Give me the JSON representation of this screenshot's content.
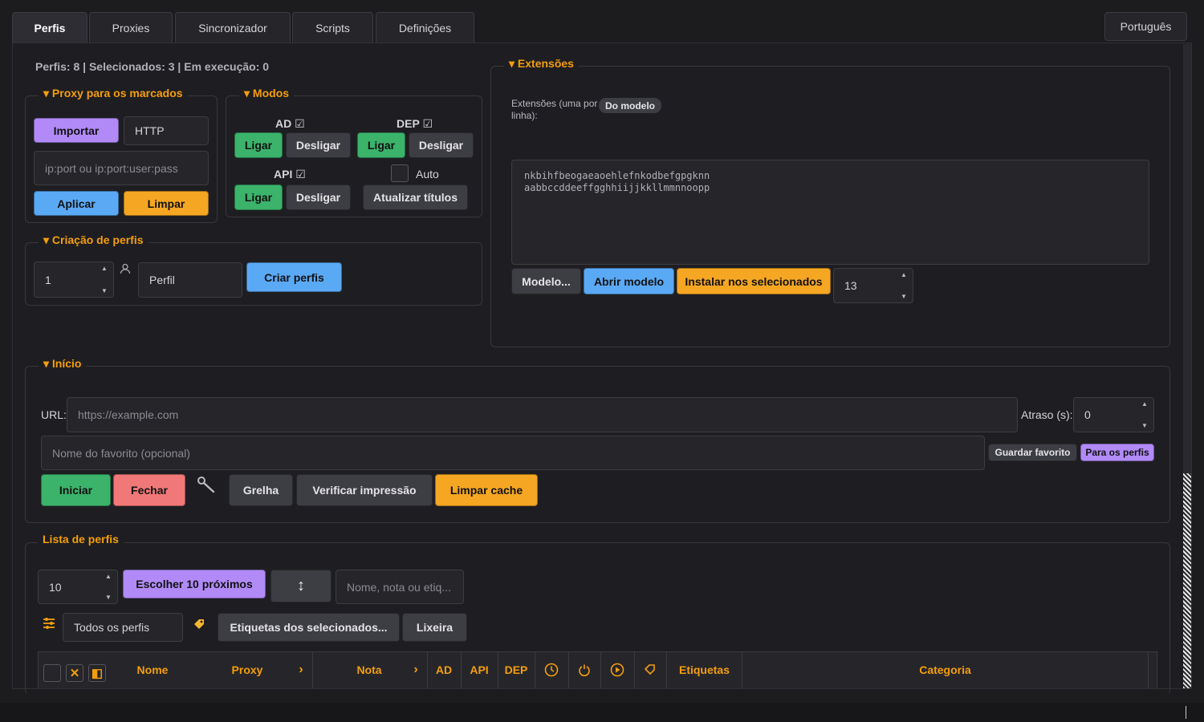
{
  "tabs": [
    "Perfis",
    "Proxies",
    "Sincronizador",
    "Scripts",
    "Definições"
  ],
  "language": "Português",
  "status": "Perfis: 8 | Selecionados: 3 | Em execução: 0",
  "proxy": {
    "title": "Proxy para os marcados",
    "import": "Importar",
    "type": "HTTP",
    "placeholder": "ip:port ou ip:port:user:pass",
    "apply": "Aplicar",
    "clear": "Limpar"
  },
  "modes": {
    "title": "Modos",
    "ad": "AD",
    "dep": "DEP",
    "api": "API",
    "check": "☑",
    "on": "Ligar",
    "off": "Desligar",
    "auto": "Auto",
    "refresh": "Atualizar títulos"
  },
  "creation": {
    "title": "Criação de perfis",
    "count": "1",
    "name": "Perfil",
    "create": "Criar perfis"
  },
  "extensions": {
    "title": "Extensões",
    "label": "Extensões (uma por linha):",
    "badge": "Do modelo",
    "lines": [
      "nkbihfbeogaeaoehlefnkodbefgpgknn",
      "aabbccddeeffgghhiijjkkllmmnnoopp"
    ],
    "model": "Modelo...",
    "open": "Abrir modelo",
    "install": "Instalar nos selecionados",
    "num": "13"
  },
  "start": {
    "title": "Início",
    "url_label": "URL:",
    "url_placeholder": "https://example.com",
    "delay_label": "Atraso (s):",
    "delay": "0",
    "fav_placeholder": "Nome do favorito (opcional)",
    "save_fav": "Guardar favorito",
    "to_profiles": "Para os perfis",
    "start": "Iniciar",
    "close": "Fechar",
    "grid": "Grelha",
    "verify": "Verificar impressão",
    "clear_cache": "Limpar cache"
  },
  "list": {
    "title": "Lista de perfis",
    "count": "10",
    "choose": "Escolher 10 próximos",
    "search_placeholder": "Nome, nota ou etiq...",
    "filter": "Todos os perfis",
    "tags": "Etiquetas dos selecionados...",
    "trash": "Lixeira"
  },
  "columns": {
    "name": "Nome",
    "proxy": "Proxy",
    "note": "Nota",
    "ad": "AD",
    "api": "API",
    "dep": "DEP",
    "tags": "Etiquetas",
    "category": "Categoria"
  },
  "colors": {
    "accent": "#f59e0b",
    "purple": "#b18af7",
    "blue": "#5aa9f5",
    "green": "#3bb36b",
    "red": "#f17878"
  }
}
